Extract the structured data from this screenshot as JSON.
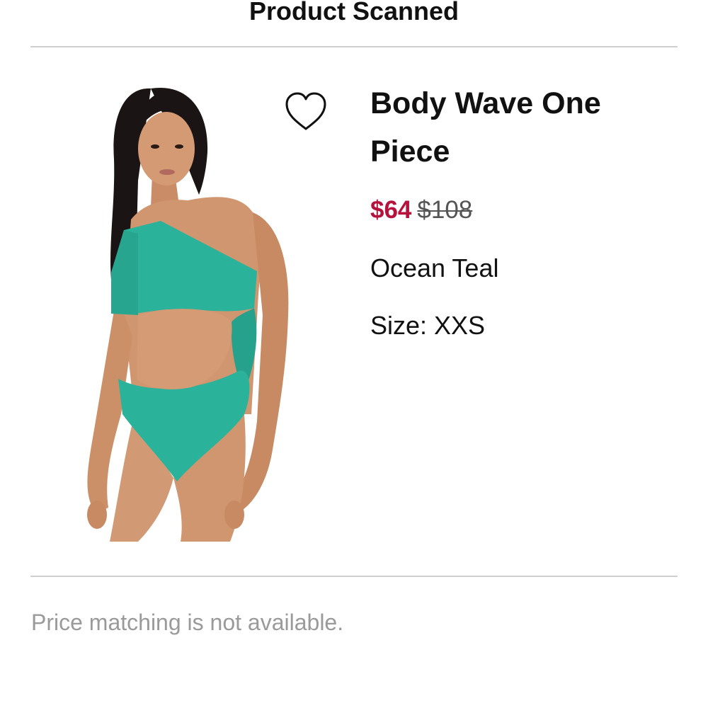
{
  "header": {
    "title": "Product Scanned"
  },
  "product": {
    "name": "Body Wave One Piece",
    "sale_price": "$64",
    "original_price": "$108",
    "color": "Ocean Teal",
    "size": "Size: XXS",
    "image_alt": "Model wearing teal one-shoulder cutout one-piece swimsuit",
    "favorite_icon": "heart-outline-icon"
  },
  "notice": {
    "text": "Price matching is not available."
  },
  "colors": {
    "sale_price": "#b5123c",
    "swimsuit": "#2bb29a",
    "notice_text": "#9a9a9a"
  }
}
